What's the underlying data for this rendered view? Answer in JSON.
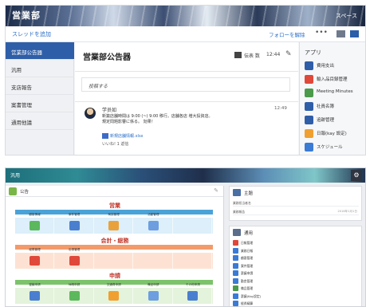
{
  "colors": {
    "primary_blue": "#2f5ea8",
    "link_blue": "#2b6fc8",
    "section_red": "#c2372b",
    "eigyo_bar": "#4aa3d8",
    "kaikei_bar": "#f39a6b",
    "shinsei_bar": "#7cc36b"
  },
  "top": {
    "banner": {
      "title": "営業部",
      "space_label": "スペース"
    },
    "toolbar": {
      "add_thread": "スレッドを追加",
      "follow": "フォローを解除",
      "more": "•••"
    },
    "sidebar": {
      "items": [
        {
          "label": "営業部公告器",
          "active": true
        },
        {
          "label": "汎用"
        },
        {
          "label": "支店報告"
        },
        {
          "label": "案書管理"
        },
        {
          "label": "通用他議"
        }
      ]
    },
    "main": {
      "title": "営業部公告器",
      "member_label": "伝表 数",
      "member_time": "12:44",
      "edit_icon": "✎",
      "compose_placeholder": "投稿する",
      "post": {
        "author": "学员如",
        "time": "12:49",
        "body_line1": "新築店舗時間は 9:00 (~) 9:00 移行。店舗各店 増大投資店。",
        "body_line2": "規定問題影響に係る。 効果！",
        "link": "新規店舗情報.xlsx",
        "actions": "いいね! 1   返信"
      }
    },
    "apps": {
      "header": "アプリ",
      "items": [
        {
          "label": "費用支出",
          "icon": "expense-icon",
          "color": "#2f5ea8"
        },
        {
          "label": "輸入品目録管理",
          "icon": "import-icon",
          "color": "#e0483a"
        },
        {
          "label": "Meeting Minutes",
          "icon": "minutes-icon",
          "color": "#4a9a4a"
        },
        {
          "label": "社員名簿",
          "icon": "staff-icon",
          "color": "#2f5ea8"
        },
        {
          "label": "追跡管理",
          "icon": "tracking-icon",
          "color": "#2f5ea8"
        },
        {
          "label": "日報(kay 設定)",
          "icon": "daily-icon",
          "color": "#f0a030"
        },
        {
          "label": "スケジュール",
          "icon": "schedule-icon",
          "color": "#3a7bd5"
        }
      ]
    }
  },
  "bottom": {
    "banner": {
      "label": "汎用",
      "gear": "⚙"
    },
    "left": {
      "header": "公告",
      "tool": "✎",
      "sections": [
        {
          "title": "営業",
          "bar_color": "#4aa3d8",
          "cell_bg": "#dceffa",
          "cells": [
            {
              "label": "顧客情報",
              "icon": "customer-icon",
              "color": "#5cb85c"
            },
            {
              "label": "案件管理",
              "icon": "deal-icon",
              "color": "#4a7fd0"
            },
            {
              "label": "商談管理",
              "icon": "meeting-icon",
              "color": "#e9a23b"
            },
            {
              "label": "活動管理",
              "icon": "activity-icon",
              "color": "#6c9ee0"
            },
            {
              "label": "",
              "icon": "",
              "color": ""
            }
          ]
        },
        {
          "title": "会計・総務",
          "bar_color": "#f39a6b",
          "cell_bg": "#fde2d3",
          "cells": [
            {
              "label": "経費管理",
              "icon": "expense-icon",
              "color": "#e0483a"
            },
            {
              "label": "出張管理",
              "icon": "trip-icon",
              "color": "#e0483a"
            },
            {
              "label": "",
              "icon": "",
              "color": ""
            },
            {
              "label": "",
              "icon": "",
              "color": ""
            },
            {
              "label": "",
              "icon": "",
              "color": ""
            }
          ]
        },
        {
          "title": "申請",
          "bar_color": "#7cc36b",
          "cell_bg": "#e4f3dc",
          "cells": [
            {
              "label": "稟議申請",
              "icon": "approval-icon",
              "color": "#4a7fd0"
            },
            {
              "label": "休暇申請",
              "icon": "leave-icon",
              "color": "#5cb85c"
            },
            {
              "label": "交通費申請",
              "icon": "transport-icon",
              "color": "#f0a030"
            },
            {
              "label": "備品申請",
              "icon": "supplies-icon",
              "color": "#6c9ee0"
            },
            {
              "label": "その他申請",
              "icon": "other-icon",
              "color": "#4a7fd0"
            }
          ]
        }
      ]
    },
    "right": {
      "card1": {
        "header": "主題",
        "rows": [
          {
            "label": "業務担当者名",
            "right": ""
          },
          {
            "label": "業務報告",
            "right": "2016年1月1日"
          }
        ]
      },
      "card2": {
        "header": "通用",
        "apps": [
          {
            "label": "日報管理",
            "color": "#e0483a"
          },
          {
            "label": "業務日報",
            "color": "#3a7bd5"
          },
          {
            "label": "顧客管理",
            "color": "#3a7bd5"
          },
          {
            "label": "案件管理",
            "color": "#3a7bd5"
          },
          {
            "label": "稟議申請",
            "color": "#3a7bd5"
          },
          {
            "label": "勤怠管理",
            "color": "#3a7bd5"
          },
          {
            "label": "備品管理",
            "color": "#4a9a4a"
          },
          {
            "label": "稟議(Kay設定)",
            "color": "#3a7bd5"
          },
          {
            "label": "経費精算",
            "color": "#3a7bd5"
          }
        ]
      }
    }
  }
}
